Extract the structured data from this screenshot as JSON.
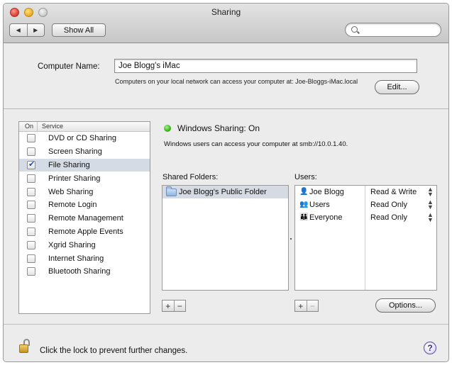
{
  "window": {
    "title": "Sharing"
  },
  "toolbar": {
    "back_label": "◀",
    "forward_label": "▶",
    "show_all_label": "Show All",
    "search_placeholder": ""
  },
  "computer_name": {
    "label": "Computer Name:",
    "value": "Joe Blogg's iMac",
    "note": "Computers on your local network can access your computer at: Joe-Bloggs-iMac.local",
    "edit_label": "Edit..."
  },
  "services": {
    "header_on": "On",
    "header_service": "Service",
    "items": [
      {
        "name": "DVD or CD Sharing",
        "checked": false
      },
      {
        "name": "Screen Sharing",
        "checked": false
      },
      {
        "name": "File Sharing",
        "checked": true
      },
      {
        "name": "Printer Sharing",
        "checked": false
      },
      {
        "name": "Web Sharing",
        "checked": false
      },
      {
        "name": "Remote Login",
        "checked": false
      },
      {
        "name": "Remote Management",
        "checked": false
      },
      {
        "name": "Remote Apple Events",
        "checked": false
      },
      {
        "name": "Xgrid Sharing",
        "checked": false
      },
      {
        "name": "Internet Sharing",
        "checked": false
      },
      {
        "name": "Bluetooth Sharing",
        "checked": false
      }
    ]
  },
  "status": {
    "text": "Windows Sharing: On",
    "description": "Windows users can access your computer at smb://10.0.1.40.",
    "color": "#37b51a"
  },
  "shared_folders": {
    "label": "Shared Folders:",
    "items": [
      "Joe Blogg's Public Folder"
    ],
    "add_label": "+",
    "remove_label": "−"
  },
  "users": {
    "label": "Users:",
    "items": [
      {
        "name": "Joe Blogg",
        "permission": "Read & Write",
        "icon": "single-user-icon"
      },
      {
        "name": "Users",
        "permission": "Read Only",
        "icon": "group-icon"
      },
      {
        "name": "Everyone",
        "permission": "Read Only",
        "icon": "everyone-icon"
      }
    ],
    "add_label": "+",
    "remove_label": "−",
    "options_label": "Options..."
  },
  "footer": {
    "lock_text": "Click the lock to prevent further changes.",
    "help_label": "?"
  }
}
